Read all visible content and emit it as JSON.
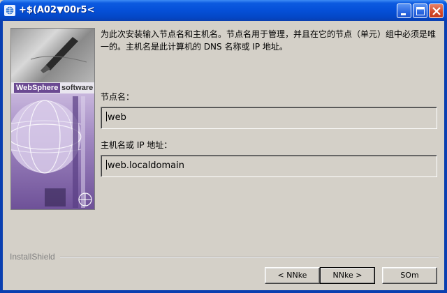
{
  "window": {
    "title": "+$(A02▼00r5<",
    "app_icon": "globe-icon",
    "controls": [
      "minimize-icon",
      "maximize-icon",
      "close-icon"
    ]
  },
  "banner": {
    "brand_name": "WebSphere",
    "brand_suffix": "software"
  },
  "content": {
    "description_line1": "为此次安装输入节点名和主机名。节点名用于管理，并且在它的节点（单元）组中必须是唯",
    "description_line2": "一的。主机名是此计算机的 DNS 名称或 IP 地址。",
    "node_label": "节点名：",
    "node_value": "web",
    "host_label": "主机名或 IP 地址：",
    "host_value": "web.localdomain"
  },
  "footer": {
    "installshield": "InstallShield",
    "back_label": "< NNke",
    "next_label": "NNke >",
    "cancel_label": "SOm"
  },
  "colors": {
    "titlebar": "#0550d8",
    "client_bg": "#d4d0c8",
    "brand_purple": "#6b4a92"
  }
}
